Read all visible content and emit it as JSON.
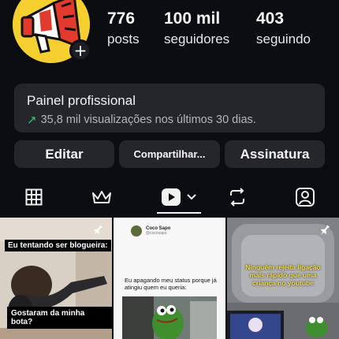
{
  "profile": {
    "stats": [
      {
        "value": "776",
        "label": "posts"
      },
      {
        "value": "100 mil",
        "label": "seguidores"
      },
      {
        "value": "403",
        "label": "seguindo"
      }
    ],
    "add_symbol": "+"
  },
  "panel": {
    "title": "Painel profissional",
    "subtitle": "35,8 mil visualizações nos últimos 30 dias.",
    "trend_glyph": "↗",
    "accent": "#38c172"
  },
  "buttons": {
    "edit": "Editar",
    "share": "Compartilhar...",
    "subscription": "Assinatura"
  },
  "tabs": [
    {
      "name": "grid-icon"
    },
    {
      "name": "crown-icon"
    },
    {
      "name": "reels-icon",
      "active": true
    },
    {
      "name": "repost-icon"
    },
    {
      "name": "tagged-icon"
    }
  ],
  "posts": [
    {
      "caption_top": "Eu tentando ser blogueira:",
      "caption_bottom": "Gostaram da minha bota?",
      "pinned": true
    },
    {
      "author": "Coco Sapo",
      "handle": "@cocosapo",
      "text": "Eu apagando meu status porque já atingiu quem eu queria:",
      "pinned": false
    },
    {
      "caption": "Ninguém rejeita ligação mais rápido que uma criança no youtube",
      "pinned": true
    }
  ],
  "colors": {
    "background": "#0c0d10",
    "surface": "#25262b",
    "avatar": "#f4cf2f"
  }
}
